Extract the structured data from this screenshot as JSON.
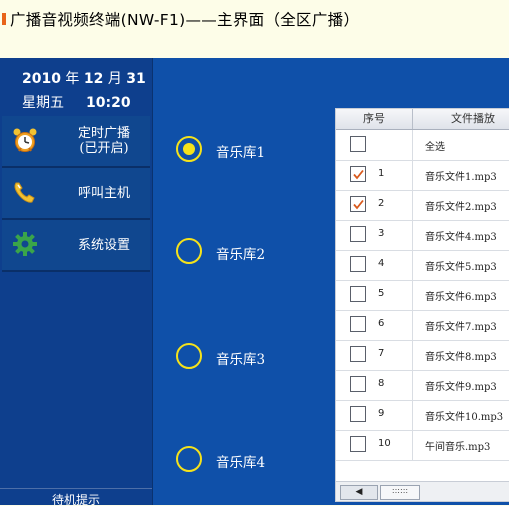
{
  "window": {
    "title": "广播音视频终端(NW-F1)——主界面（全区广播）"
  },
  "sidebar": {
    "date": {
      "year": "2010",
      "year_unit": "年",
      "month": "12",
      "month_unit": "月",
      "day": "31"
    },
    "weekday": "星期五",
    "time": "10:20",
    "items": [
      {
        "label": "定时广播\n(已开启)",
        "icon": "alarm-clock-icon"
      },
      {
        "label": "呼叫主机",
        "icon": "phone-icon"
      },
      {
        "label": "系统设置",
        "icon": "gear-icon"
      }
    ],
    "footer": "待机提示"
  },
  "libraries": [
    {
      "label": "音乐库1",
      "selected": true
    },
    {
      "label": "音乐库2",
      "selected": false
    },
    {
      "label": "音乐库3",
      "selected": false
    },
    {
      "label": "音乐库4",
      "selected": false
    }
  ],
  "file_table": {
    "columns": [
      "序号",
      "文件播放"
    ],
    "rows": [
      {
        "num": "",
        "name": "全选",
        "checked": false
      },
      {
        "num": "1",
        "name": "音乐文件1.mp3",
        "checked": true
      },
      {
        "num": "2",
        "name": "音乐文件2.mp3",
        "checked": true
      },
      {
        "num": "3",
        "name": "音乐文件4.mp3",
        "checked": false
      },
      {
        "num": "4",
        "name": "音乐文件5.mp3",
        "checked": false
      },
      {
        "num": "5",
        "name": "音乐文件6.mp3",
        "checked": false
      },
      {
        "num": "6",
        "name": "音乐文件7.mp3",
        "checked": false
      },
      {
        "num": "7",
        "name": "音乐文件8.mp3",
        "checked": false
      },
      {
        "num": "8",
        "name": "音乐文件9.mp3",
        "checked": false
      },
      {
        "num": "9",
        "name": "音乐文件10.mp3",
        "checked": false
      },
      {
        "num": "10",
        "name": "午间音乐.mp3",
        "checked": false
      }
    ],
    "scroll_left": "◀",
    "scroll_thumb": "::::::"
  },
  "colors": {
    "accent_yellow": "#f5e21b",
    "check_orange": "#d9591c",
    "panel_blue": "#0f50a9",
    "sidebar_blue": "#0e3f8d"
  }
}
